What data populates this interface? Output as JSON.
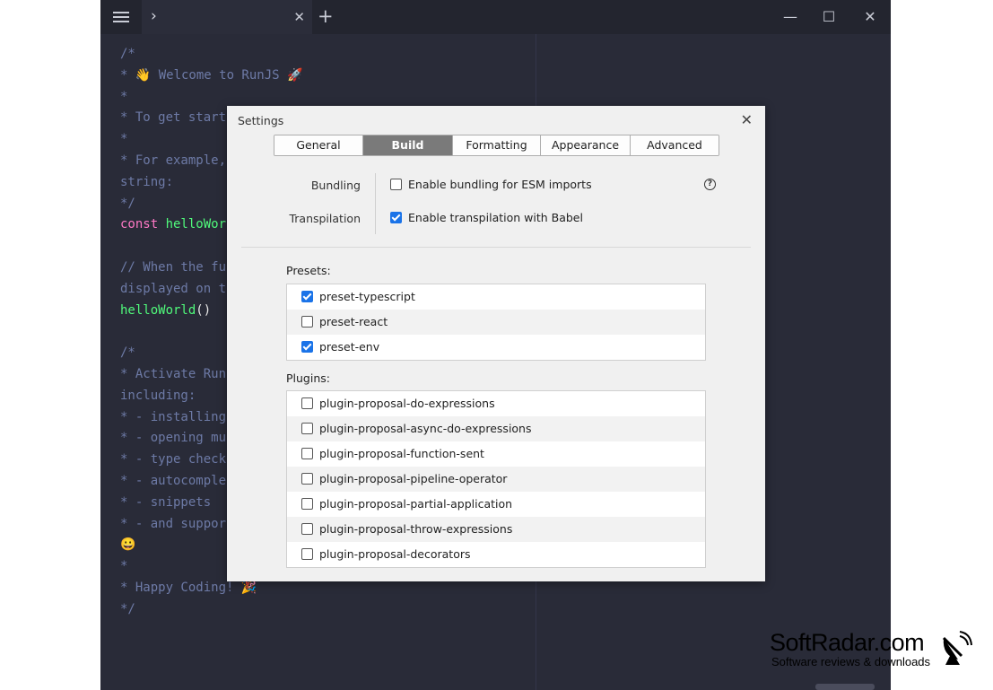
{
  "tab": {
    "chevron": "›",
    "close": "✕"
  },
  "titlebar": {
    "add": "+",
    "minimize": "—",
    "maximize": "☐",
    "close": "✕"
  },
  "editor": {
    "lines": [
      [
        [
          "c",
          "/*"
        ]
      ],
      [
        [
          "c",
          "* 👋 Welcome to RunJS 🚀"
        ]
      ],
      [
        [
          "c",
          "*"
        ]
      ],
      [
        [
          "c",
          "* To get start"
        ]
      ],
      [
        [
          "c",
          "*"
        ]
      ],
      [
        [
          "c",
          "* For example,"
        ]
      ],
      [
        [
          "c",
          "string:"
        ]
      ],
      [
        [
          "c",
          "*/"
        ]
      ],
      [
        [
          "k",
          "const "
        ],
        [
          "f",
          "helloWor"
        ]
      ],
      [
        [
          "c",
          ""
        ]
      ],
      [
        [
          "c",
          "// When the fu"
        ]
      ],
      [
        [
          "c",
          "displayed on t"
        ]
      ],
      [
        [
          "f",
          "helloWorld"
        ],
        [
          "p",
          "()"
        ]
      ],
      [
        [
          "c",
          ""
        ]
      ],
      [
        [
          "c",
          "/*"
        ]
      ],
      [
        [
          "c",
          "* Activate Run"
        ]
      ],
      [
        [
          "c",
          "including:"
        ]
      ],
      [
        [
          "c",
          "* - installing"
        ]
      ],
      [
        [
          "c",
          "* - opening mu"
        ]
      ],
      [
        [
          "c",
          "* - type check"
        ]
      ],
      [
        [
          "c",
          "* - autocomple"
        ]
      ],
      [
        [
          "c",
          "* - snippets"
        ]
      ],
      [
        [
          "c",
          "* - and suppor"
        ]
      ],
      [
        [
          "c",
          "😀"
        ]
      ],
      [
        [
          "c",
          "*"
        ]
      ],
      [
        [
          "c",
          "* Happy Coding! 🎉"
        ]
      ],
      [
        [
          "c",
          "*/"
        ]
      ]
    ]
  },
  "settings": {
    "title": "Settings",
    "close": "✕",
    "tabs": [
      "General",
      "Build",
      "Formatting",
      "Appearance",
      "Advanced"
    ],
    "active_tab": "Build",
    "bundling_label": "Bundling",
    "bundling_option": "Enable bundling for ESM imports",
    "bundling_checked": false,
    "help": "?",
    "transpilation_label": "Transpilation",
    "transpilation_option": "Enable transpilation with Babel",
    "transpilation_checked": true,
    "presets_label": "Presets:",
    "presets": [
      {
        "label": "preset-typescript",
        "checked": true
      },
      {
        "label": "preset-react",
        "checked": false
      },
      {
        "label": "preset-env",
        "checked": true
      }
    ],
    "plugins_label": "Plugins:",
    "plugins": [
      {
        "label": "plugin-proposal-do-expressions",
        "checked": false
      },
      {
        "label": "plugin-proposal-async-do-expressions",
        "checked": false
      },
      {
        "label": "plugin-proposal-function-sent",
        "checked": false
      },
      {
        "label": "plugin-proposal-pipeline-operator",
        "checked": false
      },
      {
        "label": "plugin-proposal-partial-application",
        "checked": false
      },
      {
        "label": "plugin-proposal-throw-expressions",
        "checked": false
      },
      {
        "label": "plugin-proposal-decorators",
        "checked": false
      }
    ]
  },
  "watermark": {
    "name": "SoftRadar.com",
    "tagline": "Software reviews & downloads"
  }
}
